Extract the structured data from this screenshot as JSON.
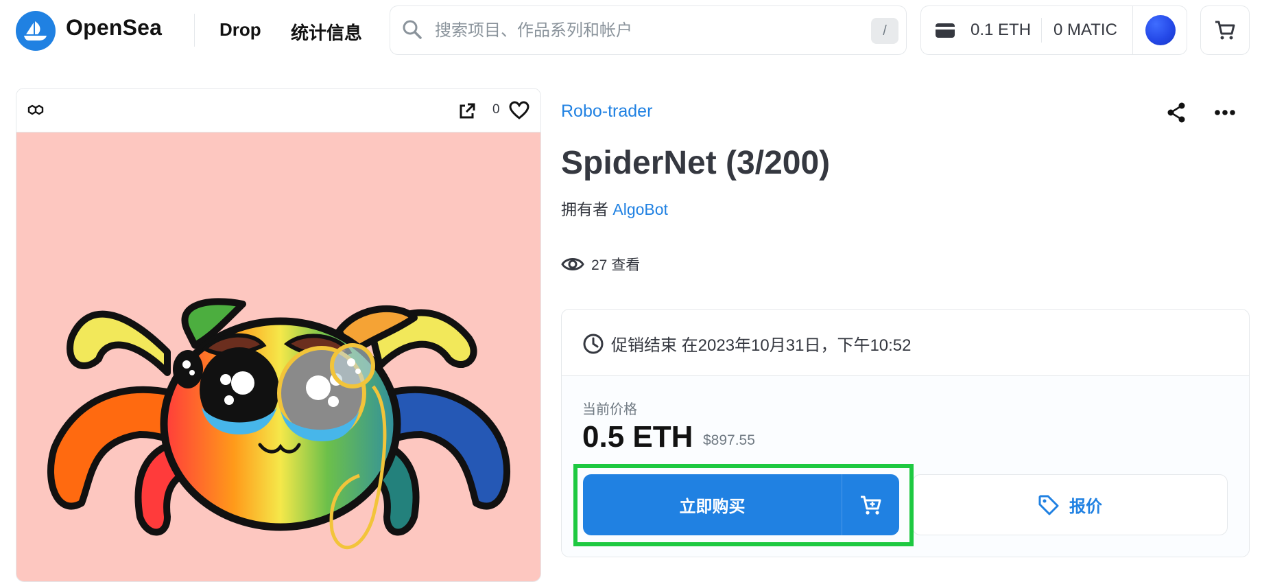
{
  "header": {
    "logo_text": "OpenSea",
    "nav": [
      {
        "label": "Drop"
      },
      {
        "label": "统计信息"
      }
    ],
    "search": {
      "placeholder": "搜索项目、作品系列和帐户",
      "value": "",
      "shortcut": "/"
    },
    "wallet": {
      "eth_balance": "0.1 ETH",
      "matic_balance": "0 MATIC"
    },
    "icons": [
      "opensea-logo-icon",
      "search-icon",
      "wallet-icon",
      "avatar",
      "cart-icon"
    ]
  },
  "image_card": {
    "favorite_count": "0",
    "icons": [
      "polygon-icon",
      "external-link-icon",
      "heart-icon"
    ]
  },
  "item": {
    "collection": "Robo-trader",
    "title": "SpiderNet (3/200)",
    "owner_prefix": "拥有者",
    "owner_name": "AlgoBot",
    "views": "27 查看",
    "icons": [
      "share-icon",
      "more-icon",
      "eye-icon"
    ]
  },
  "sale": {
    "end_text": "促销结束 在2023年10月31日，下午10:52",
    "current_price_label": "当前价格",
    "price": "0.5 ETH",
    "price_usd": "$897.55",
    "buy_now_label": "立即购买",
    "offer_label": "报价",
    "icons": [
      "clock-icon",
      "add-to-cart-icon",
      "tag-icon"
    ]
  },
  "colors": {
    "accent": "#2081e2",
    "highlight_box": "#1ec941",
    "nft_background": "#fdc7c0"
  }
}
